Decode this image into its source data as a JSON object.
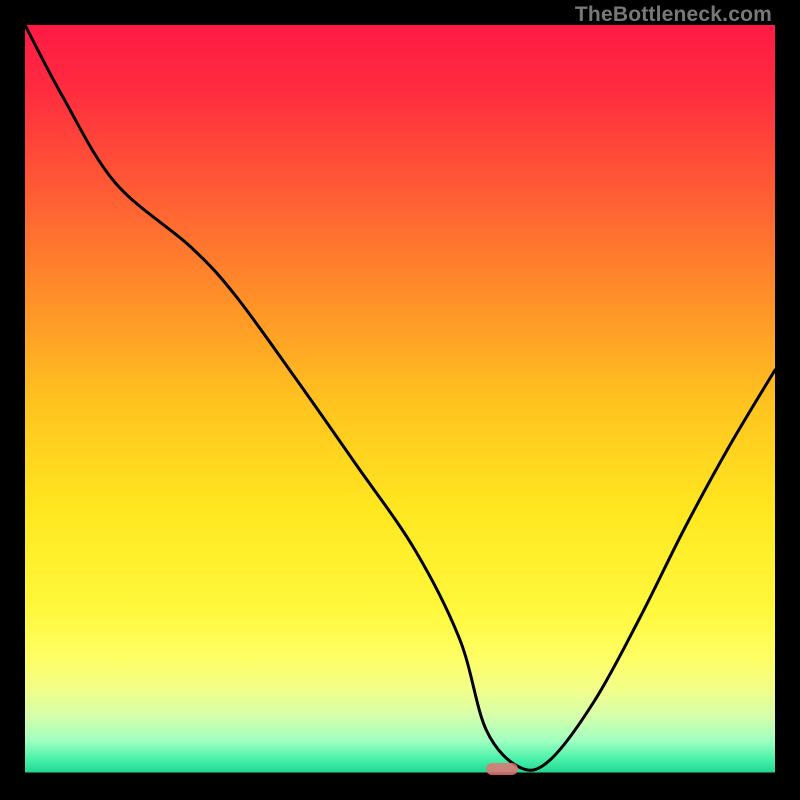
{
  "watermark": "TheBottleneck.com",
  "gradient_stops": [
    {
      "offset": 0.0,
      "color": "#ff1a44"
    },
    {
      "offset": 0.08,
      "color": "#ff2a40"
    },
    {
      "offset": 0.2,
      "color": "#ff5436"
    },
    {
      "offset": 0.35,
      "color": "#ff8a2a"
    },
    {
      "offset": 0.5,
      "color": "#ffc21f"
    },
    {
      "offset": 0.65,
      "color": "#ffe820"
    },
    {
      "offset": 0.78,
      "color": "#fff83c"
    },
    {
      "offset": 0.845,
      "color": "#ffff66"
    },
    {
      "offset": 0.885,
      "color": "#f2ff88"
    },
    {
      "offset": 0.92,
      "color": "#d8ffaa"
    },
    {
      "offset": 0.955,
      "color": "#9effc0"
    },
    {
      "offset": 0.98,
      "color": "#45f0a8"
    },
    {
      "offset": 1.0,
      "color": "#18d28e"
    }
  ],
  "marker": {
    "x_frac": 0.636,
    "y_frac": 0.992,
    "color": "#e57373"
  },
  "chart_data": {
    "type": "line",
    "title": "",
    "xlabel": "",
    "ylabel": "",
    "xlim": [
      0,
      1
    ],
    "ylim": [
      0,
      1
    ],
    "series": [
      {
        "name": "curve",
        "x": [
          0.0,
          0.05,
          0.12,
          0.22,
          0.28,
          0.36,
          0.44,
          0.52,
          0.58,
          0.615,
          0.66,
          0.7,
          0.76,
          0.82,
          0.88,
          0.94,
          1.0
        ],
        "y": [
          1.0,
          0.905,
          0.79,
          0.705,
          0.64,
          0.53,
          0.416,
          0.3,
          0.18,
          0.06,
          0.01,
          0.02,
          0.1,
          0.21,
          0.33,
          0.44,
          0.54
        ]
      }
    ],
    "marker_point": {
      "x": 0.636,
      "y": 0.008
    }
  }
}
